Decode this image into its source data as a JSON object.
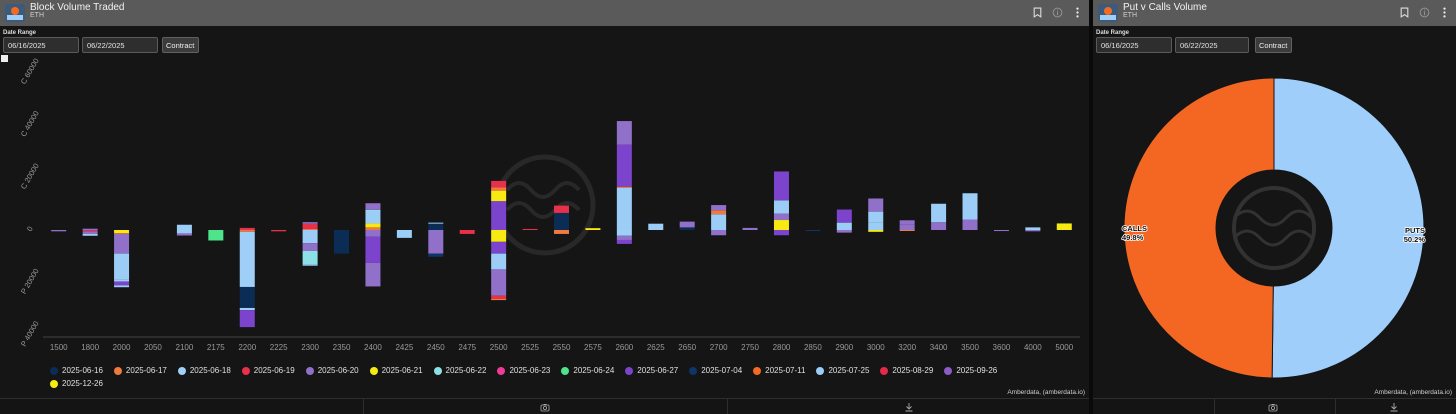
{
  "left_panel": {
    "title": "Block Volume Traded",
    "subtitle": "ETH",
    "date_label": "Date Range",
    "date_from": "06/16/2025",
    "date_to": "06/22/2025",
    "contract_label": "Contract",
    "credit": "Amberdata, (amberdata.io)"
  },
  "right_panel": {
    "title": "Put v Calls Volume",
    "subtitle": "ETH",
    "date_label": "Date Range",
    "date_from": "06/16/2025",
    "date_to": "06/22/2025",
    "contract_label": "Contract",
    "credit": "Amberdata, (amberdata.io)"
  },
  "legend_colors": {
    "2025-06-16": "#0b2d55",
    "2025-06-17": "#ef7a3f",
    "2025-06-18": "#9fcff6",
    "2025-06-19": "#e7304a",
    "2025-06-20": "#9070c8",
    "2025-06-21": "#f7ea12",
    "2025-06-22": "#8ce1e7",
    "2025-06-23": "#ee3b97",
    "2025-06-24": "#4de48b",
    "2025-06-27": "#7c44cc",
    "2025-07-04": "#0d3666",
    "2025-07-11": "#f26b20",
    "2025-07-25": "#9ccdf7",
    "2025-08-29": "#e52a47",
    "2025-09-26": "#8d5ac6",
    "2025-12-26": "#f6ee11"
  },
  "chart_data": [
    {
      "type": "bar",
      "stacked": true,
      "y_tick_labels": [
        "C 60000",
        "C 40000",
        "C 20000",
        "0",
        "P 20000",
        "P 40000"
      ],
      "ylim": [
        -40000,
        60000
      ],
      "grid": false,
      "legend_position": "bottom",
      "categories": [
        "1500",
        "1800",
        "2000",
        "2050",
        "2100",
        "2175",
        "2200",
        "2225",
        "2300",
        "2350",
        "2400",
        "2425",
        "2450",
        "2475",
        "2500",
        "2525",
        "2550",
        "2575",
        "2600",
        "2625",
        "2650",
        "2700",
        "2750",
        "2800",
        "2850",
        "2900",
        "3000",
        "3200",
        "3400",
        "3500",
        "3600",
        "4000",
        "5000"
      ],
      "legend": [
        "2025-06-16",
        "2025-06-17",
        "2025-06-18",
        "2025-06-19",
        "2025-06-20",
        "2025-06-21",
        "2025-06-22",
        "2025-06-23",
        "2025-06-24",
        "2025-06-27",
        "2025-07-04",
        "2025-07-11",
        "2025-07-25",
        "2025-08-29",
        "2025-09-26",
        "2025-12-26"
      ],
      "bars": [
        {
          "strike": "1500",
          "segs": [
            [
              "2025-06-20",
              -500
            ]
          ]
        },
        {
          "strike": "1800",
          "segs": [
            [
              "2025-06-19",
              -500
            ],
            [
              "2025-06-20",
              -1000
            ],
            [
              "2025-07-25",
              -700
            ],
            [
              "2025-06-20",
              500
            ]
          ]
        },
        {
          "strike": "2000",
          "segs": [
            [
              "2025-06-21",
              -1200
            ],
            [
              "2025-06-17",
              -300
            ],
            [
              "2025-06-20",
              -7500
            ],
            [
              "2025-07-25",
              -10000
            ],
            [
              "2025-06-18",
              -600
            ],
            [
              "2025-06-27",
              -1500
            ],
            [
              "2025-07-25",
              -700
            ]
          ]
        },
        {
          "strike": "2100",
          "segs": [
            [
              "2025-07-25",
              -1300
            ],
            [
              "2025-06-20",
              -800
            ],
            [
              "2025-07-25",
              2000
            ]
          ]
        },
        {
          "strike": "2175",
          "segs": [
            [
              "2025-06-24",
              -4000
            ]
          ]
        },
        {
          "strike": "2200",
          "segs": [
            [
              "2025-06-17",
              -700
            ],
            [
              "2025-06-18",
              -21000
            ],
            [
              "2025-06-16",
              -8000
            ],
            [
              "2025-06-18",
              -800
            ],
            [
              "2025-06-27",
              -6500
            ],
            [
              "2025-06-19",
              800
            ]
          ]
        },
        {
          "strike": "2225",
          "segs": [
            [
              "2025-06-19",
              -500
            ]
          ]
        },
        {
          "strike": "2300",
          "segs": [
            [
              "2025-07-25",
              -5000
            ],
            [
              "2025-06-20",
              -3000
            ],
            [
              "2025-06-22",
              -5000
            ],
            [
              "2025-06-18",
              -600
            ],
            [
              "2025-06-17",
              400
            ],
            [
              "2025-06-19",
              2000
            ],
            [
              "2025-06-20",
              600
            ]
          ]
        },
        {
          "strike": "2350",
          "segs": [
            [
              "2025-06-16",
              -9000
            ]
          ]
        },
        {
          "strike": "2400",
          "segs": [
            [
              "2025-06-20",
              -2500
            ],
            [
              "2025-06-27",
              -10000
            ],
            [
              "2025-06-20",
              -9000
            ],
            [
              "2025-06-17",
              1000
            ],
            [
              "2025-06-21",
              1500
            ],
            [
              "2025-07-25",
              5000
            ],
            [
              "2025-06-22",
              200
            ],
            [
              "2025-06-20",
              2500
            ]
          ]
        },
        {
          "strike": "2425",
          "segs": [
            [
              "2025-07-25",
              -3000
            ]
          ]
        },
        {
          "strike": "2450",
          "segs": [
            [
              "2025-06-20",
              -9000
            ],
            [
              "2025-07-04",
              -1200
            ],
            [
              "2025-06-16",
              2500
            ],
            [
              "2025-07-25",
              300
            ]
          ]
        },
        {
          "strike": "2475",
          "segs": [
            [
              "2025-06-19",
              -1500
            ]
          ]
        },
        {
          "strike": "2500",
          "segs": [
            [
              "2025-06-21",
              -4500
            ],
            [
              "2025-06-27",
              -4500
            ],
            [
              "2025-07-25",
              -6000
            ],
            [
              "2025-06-20",
              -10000
            ],
            [
              "2025-06-19",
              -1200
            ],
            [
              "2025-06-17",
              -500
            ],
            [
              "2025-06-27",
              11000
            ],
            [
              "2025-06-21",
              4000
            ],
            [
              "2025-06-17",
              1200
            ],
            [
              "2025-06-19",
              2500
            ]
          ]
        },
        {
          "strike": "2525",
          "segs": [
            [
              "2025-06-19",
              400
            ]
          ]
        },
        {
          "strike": "2550",
          "segs": [
            [
              "2025-06-17",
              -1500
            ],
            [
              "2025-06-16",
              6500
            ],
            [
              "2025-06-19",
              2800
            ]
          ]
        },
        {
          "strike": "2575",
          "segs": [
            [
              "2025-06-21",
              700
            ]
          ]
        },
        {
          "strike": "2600",
          "segs": [
            [
              "2025-06-18",
              -2200
            ],
            [
              "2025-06-20",
              -1600
            ],
            [
              "2025-06-27",
              -1500
            ],
            [
              "2025-07-25",
              16000
            ],
            [
              "2025-06-17",
              500
            ],
            [
              "2025-06-27",
              16000
            ],
            [
              "2025-06-20",
              9000
            ]
          ]
        },
        {
          "strike": "2625",
          "segs": [
            [
              "2025-07-25",
              2400
            ]
          ]
        },
        {
          "strike": "2650",
          "segs": [
            [
              "2025-06-16",
              1000
            ],
            [
              "2025-06-20",
              2200
            ]
          ]
        },
        {
          "strike": "2700",
          "segs": [
            [
              "2025-06-20",
              -2000
            ],
            [
              "2025-07-25",
              6000
            ],
            [
              "2025-06-17",
              1500
            ],
            [
              "2025-06-20",
              2000
            ]
          ]
        },
        {
          "strike": "2750",
          "segs": [
            [
              "2025-06-20",
              800
            ]
          ]
        },
        {
          "strike": "2800",
          "segs": [
            [
              "2025-06-27",
              -2000
            ],
            [
              "2025-06-21",
              3800
            ],
            [
              "2025-06-20",
              2500
            ],
            [
              "2025-07-25",
              5000
            ],
            [
              "2025-06-27",
              11000
            ]
          ]
        },
        {
          "strike": "2850",
          "segs": [
            [
              "2025-07-04",
              -300
            ]
          ]
        },
        {
          "strike": "2900",
          "segs": [
            [
              "2025-06-20",
              -1000
            ],
            [
              "2025-07-25",
              2800
            ],
            [
              "2025-06-27",
              5000
            ]
          ]
        },
        {
          "strike": "3000",
          "segs": [
            [
              "2025-06-21",
              -700
            ],
            [
              "2025-07-25",
              3000
            ],
            [
              "2025-07-25",
              4000
            ],
            [
              "2025-06-20",
              5000
            ]
          ]
        },
        {
          "strike": "3200",
          "segs": [
            [
              "2025-06-17",
              -300
            ],
            [
              "2025-06-20",
              2000
            ],
            [
              "2025-06-20",
              1700
            ]
          ]
        },
        {
          "strike": "3400",
          "segs": [
            [
              "2025-06-20",
              3000
            ],
            [
              "2025-07-25",
              7000
            ]
          ]
        },
        {
          "strike": "3500",
          "segs": [
            [
              "2025-06-20",
              4000
            ],
            [
              "2025-07-25",
              10000
            ]
          ]
        },
        {
          "strike": "3600",
          "segs": [
            [
              "2025-06-20",
              -400
            ]
          ]
        },
        {
          "strike": "4000",
          "segs": [
            [
              "2025-06-20",
              -500
            ],
            [
              "2025-07-25",
              1000
            ]
          ]
        },
        {
          "strike": "5000",
          "segs": [
            [
              "2025-06-21",
              2500
            ]
          ]
        }
      ]
    },
    {
      "type": "pie",
      "donut": true,
      "slices": [
        {
          "label": "CALLS",
          "value": 49.8,
          "display": "49.8%",
          "color": "#f36722"
        },
        {
          "label": "PUTS",
          "value": 50.2,
          "display": "50.2%",
          "color": "#9fcefb"
        }
      ]
    }
  ]
}
